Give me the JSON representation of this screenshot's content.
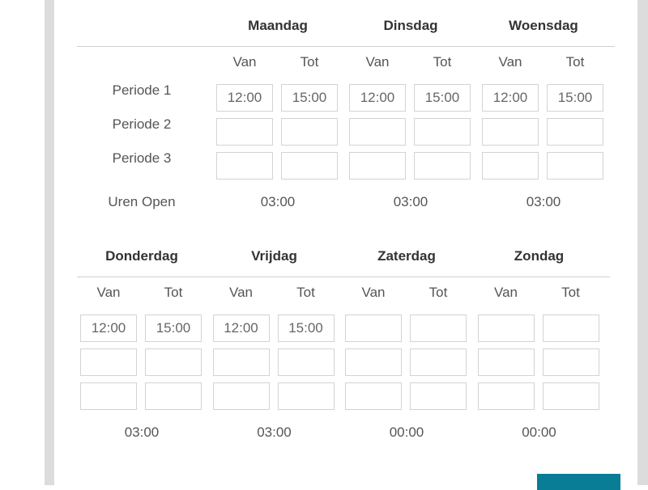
{
  "labels": {
    "van": "Van",
    "tot": "Tot",
    "periods": [
      "Periode 1",
      "Periode 2",
      "Periode 3"
    ],
    "total_label": "Uren Open"
  },
  "days": [
    {
      "name": "Maandag",
      "periods": [
        {
          "van": "12:00",
          "tot": "15:00"
        },
        {
          "van": "",
          "tot": ""
        },
        {
          "van": "",
          "tot": ""
        }
      ],
      "total": "03:00"
    },
    {
      "name": "Dinsdag",
      "periods": [
        {
          "van": "12:00",
          "tot": "15:00"
        },
        {
          "van": "",
          "tot": ""
        },
        {
          "van": "",
          "tot": ""
        }
      ],
      "total": "03:00"
    },
    {
      "name": "Woensdag",
      "periods": [
        {
          "van": "12:00",
          "tot": "15:00"
        },
        {
          "van": "",
          "tot": ""
        },
        {
          "van": "",
          "tot": ""
        }
      ],
      "total": "03:00"
    },
    {
      "name": "Donderdag",
      "periods": [
        {
          "van": "12:00",
          "tot": "15:00"
        },
        {
          "van": "",
          "tot": ""
        },
        {
          "van": "",
          "tot": ""
        }
      ],
      "total": "03:00"
    },
    {
      "name": "Vrijdag",
      "periods": [
        {
          "van": "12:00",
          "tot": "15:00"
        },
        {
          "van": "",
          "tot": ""
        },
        {
          "van": "",
          "tot": ""
        }
      ],
      "total": "03:00"
    },
    {
      "name": "Zaterdag",
      "periods": [
        {
          "van": "",
          "tot": ""
        },
        {
          "van": "",
          "tot": ""
        },
        {
          "van": "",
          "tot": ""
        }
      ],
      "total": "00:00"
    },
    {
      "name": "Zondag",
      "periods": [
        {
          "van": "",
          "tot": ""
        },
        {
          "van": "",
          "tot": ""
        },
        {
          "van": "",
          "tot": ""
        }
      ],
      "total": "00:00"
    }
  ],
  "colors": {
    "accent": "#0a7d96"
  }
}
